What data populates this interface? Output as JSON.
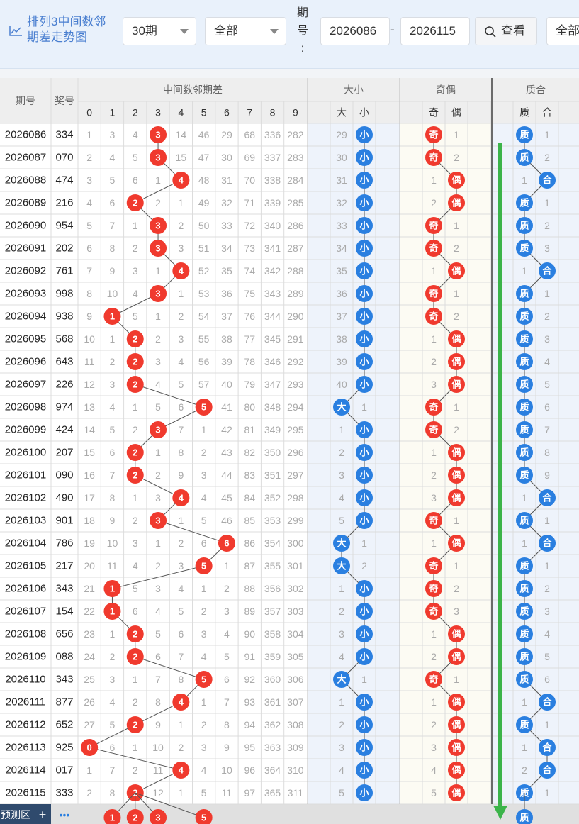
{
  "toolbar": {
    "title": "排列3中间数邻\n期差走势图",
    "period_select": "30期",
    "filter_select": "全部",
    "qihao_label": "期\n号\n:",
    "range_start": "2026086",
    "range_dash": "-",
    "range_end": "2026115",
    "view_button": "查看",
    "filter2_select": "全部"
  },
  "table": {
    "headers": {
      "qihao": "期号",
      "jianghao": "奖号",
      "group_diff": "中间数邻期差",
      "group_size": "大小",
      "group_parity": "奇偶",
      "group_prime": "质合",
      "digits": [
        "0",
        "1",
        "2",
        "3",
        "4",
        "5",
        "6",
        "7",
        "8",
        "9"
      ],
      "size_cols": [
        "大",
        "小"
      ],
      "parity_cols": [
        "奇",
        "偶"
      ],
      "prime_cols": [
        "质",
        "合"
      ]
    },
    "rows": [
      {
        "qihao": "2026086",
        "jianghao": "334",
        "diff": [
          "1",
          "3",
          "4",
          "3",
          "14",
          "46",
          "29",
          "68",
          "336",
          "282"
        ],
        "size": [
          "29",
          "小"
        ],
        "parity": [
          "奇",
          "1"
        ],
        "prime": [
          "质",
          "1"
        ]
      },
      {
        "qihao": "2026087",
        "jianghao": "070",
        "diff": [
          "2",
          "4",
          "5",
          "3",
          "15",
          "47",
          "30",
          "69",
          "337",
          "283"
        ],
        "size": [
          "30",
          "小"
        ],
        "parity": [
          "奇",
          "2"
        ],
        "prime": [
          "质",
          "2"
        ]
      },
      {
        "qihao": "2026088",
        "jianghao": "474",
        "diff": [
          "3",
          "5",
          "6",
          "1",
          "4",
          "48",
          "31",
          "70",
          "338",
          "284"
        ],
        "size": [
          "31",
          "小"
        ],
        "parity": [
          "1",
          "偶"
        ],
        "prime": [
          "1",
          "合"
        ]
      },
      {
        "qihao": "2026089",
        "jianghao": "216",
        "diff": [
          "4",
          "6",
          "2",
          "2",
          "1",
          "49",
          "32",
          "71",
          "339",
          "285"
        ],
        "size": [
          "32",
          "小"
        ],
        "parity": [
          "2",
          "偶"
        ],
        "prime": [
          "质",
          "1"
        ]
      },
      {
        "qihao": "2026090",
        "jianghao": "954",
        "diff": [
          "5",
          "7",
          "1",
          "3",
          "2",
          "50",
          "33",
          "72",
          "340",
          "286"
        ],
        "size": [
          "33",
          "小"
        ],
        "parity": [
          "奇",
          "1"
        ],
        "prime": [
          "质",
          "2"
        ]
      },
      {
        "qihao": "2026091",
        "jianghao": "202",
        "diff": [
          "6",
          "8",
          "2",
          "3",
          "3",
          "51",
          "34",
          "73",
          "341",
          "287"
        ],
        "size": [
          "34",
          "小"
        ],
        "parity": [
          "奇",
          "2"
        ],
        "prime": [
          "质",
          "3"
        ]
      },
      {
        "qihao": "2026092",
        "jianghao": "761",
        "diff": [
          "7",
          "9",
          "3",
          "1",
          "4",
          "52",
          "35",
          "74",
          "342",
          "288"
        ],
        "size": [
          "35",
          "小"
        ],
        "parity": [
          "1",
          "偶"
        ],
        "prime": [
          "1",
          "合"
        ]
      },
      {
        "qihao": "2026093",
        "jianghao": "998",
        "diff": [
          "8",
          "10",
          "4",
          "3",
          "1",
          "53",
          "36",
          "75",
          "343",
          "289"
        ],
        "size": [
          "36",
          "小"
        ],
        "parity": [
          "奇",
          "1"
        ],
        "prime": [
          "质",
          "1"
        ]
      },
      {
        "qihao": "2026094",
        "jianghao": "938",
        "diff": [
          "9",
          "1",
          "5",
          "1",
          "2",
          "54",
          "37",
          "76",
          "344",
          "290"
        ],
        "size": [
          "37",
          "小"
        ],
        "parity": [
          "奇",
          "2"
        ],
        "prime": [
          "质",
          "2"
        ]
      },
      {
        "qihao": "2026095",
        "jianghao": "568",
        "diff": [
          "10",
          "1",
          "2",
          "2",
          "3",
          "55",
          "38",
          "77",
          "345",
          "291"
        ],
        "size": [
          "38",
          "小"
        ],
        "parity": [
          "1",
          "偶"
        ],
        "prime": [
          "质",
          "3"
        ]
      },
      {
        "qihao": "2026096",
        "jianghao": "643",
        "diff": [
          "11",
          "2",
          "2",
          "3",
          "4",
          "56",
          "39",
          "78",
          "346",
          "292"
        ],
        "size": [
          "39",
          "小"
        ],
        "parity": [
          "2",
          "偶"
        ],
        "prime": [
          "质",
          "4"
        ]
      },
      {
        "qihao": "2026097",
        "jianghao": "226",
        "diff": [
          "12",
          "3",
          "2",
          "4",
          "5",
          "57",
          "40",
          "79",
          "347",
          "293"
        ],
        "size": [
          "40",
          "小"
        ],
        "parity": [
          "3",
          "偶"
        ],
        "prime": [
          "质",
          "5"
        ]
      },
      {
        "qihao": "2026098",
        "jianghao": "974",
        "diff": [
          "13",
          "4",
          "1",
          "5",
          "6",
          "5",
          "41",
          "80",
          "348",
          "294"
        ],
        "size": [
          "大",
          "1"
        ],
        "parity": [
          "奇",
          "1"
        ],
        "prime": [
          "质",
          "6"
        ]
      },
      {
        "qihao": "2026099",
        "jianghao": "424",
        "diff": [
          "14",
          "5",
          "2",
          "3",
          "7",
          "1",
          "42",
          "81",
          "349",
          "295"
        ],
        "size": [
          "1",
          "小"
        ],
        "parity": [
          "奇",
          "2"
        ],
        "prime": [
          "质",
          "7"
        ]
      },
      {
        "qihao": "2026100",
        "jianghao": "207",
        "diff": [
          "15",
          "6",
          "2",
          "1",
          "8",
          "2",
          "43",
          "82",
          "350",
          "296"
        ],
        "size": [
          "2",
          "小"
        ],
        "parity": [
          "1",
          "偶"
        ],
        "prime": [
          "质",
          "8"
        ]
      },
      {
        "qihao": "2026101",
        "jianghao": "090",
        "diff": [
          "16",
          "7",
          "2",
          "2",
          "9",
          "3",
          "44",
          "83",
          "351",
          "297"
        ],
        "size": [
          "3",
          "小"
        ],
        "parity": [
          "2",
          "偶"
        ],
        "prime": [
          "质",
          "9"
        ]
      },
      {
        "qihao": "2026102",
        "jianghao": "490",
        "diff": [
          "17",
          "8",
          "1",
          "3",
          "4",
          "4",
          "45",
          "84",
          "352",
          "298"
        ],
        "size": [
          "4",
          "小"
        ],
        "parity": [
          "3",
          "偶"
        ],
        "prime": [
          "1",
          "合"
        ]
      },
      {
        "qihao": "2026103",
        "jianghao": "901",
        "diff": [
          "18",
          "9",
          "2",
          "3",
          "1",
          "5",
          "46",
          "85",
          "353",
          "299"
        ],
        "size": [
          "5",
          "小"
        ],
        "parity": [
          "奇",
          "1"
        ],
        "prime": [
          "质",
          "1"
        ]
      },
      {
        "qihao": "2026104",
        "jianghao": "786",
        "diff": [
          "19",
          "10",
          "3",
          "1",
          "2",
          "6",
          "6",
          "86",
          "354",
          "300"
        ],
        "size": [
          "大",
          "1"
        ],
        "parity": [
          "1",
          "偶"
        ],
        "prime": [
          "1",
          "合"
        ]
      },
      {
        "qihao": "2026105",
        "jianghao": "217",
        "diff": [
          "20",
          "11",
          "4",
          "2",
          "3",
          "5",
          "1",
          "87",
          "355",
          "301"
        ],
        "size": [
          "大",
          "2"
        ],
        "parity": [
          "奇",
          "1"
        ],
        "prime": [
          "质",
          "1"
        ]
      },
      {
        "qihao": "2026106",
        "jianghao": "343",
        "diff": [
          "21",
          "1",
          "5",
          "3",
          "4",
          "1",
          "2",
          "88",
          "356",
          "302"
        ],
        "size": [
          "1",
          "小"
        ],
        "parity": [
          "奇",
          "2"
        ],
        "prime": [
          "质",
          "2"
        ]
      },
      {
        "qihao": "2026107",
        "jianghao": "154",
        "diff": [
          "22",
          "1",
          "6",
          "4",
          "5",
          "2",
          "3",
          "89",
          "357",
          "303"
        ],
        "size": [
          "2",
          "小"
        ],
        "parity": [
          "奇",
          "3"
        ],
        "prime": [
          "质",
          "3"
        ]
      },
      {
        "qihao": "2026108",
        "jianghao": "656",
        "diff": [
          "23",
          "1",
          "2",
          "5",
          "6",
          "3",
          "4",
          "90",
          "358",
          "304"
        ],
        "size": [
          "3",
          "小"
        ],
        "parity": [
          "1",
          "偶"
        ],
        "prime": [
          "质",
          "4"
        ]
      },
      {
        "qihao": "2026109",
        "jianghao": "088",
        "diff": [
          "24",
          "2",
          "2",
          "6",
          "7",
          "4",
          "5",
          "91",
          "359",
          "305"
        ],
        "size": [
          "4",
          "小"
        ],
        "parity": [
          "2",
          "偶"
        ],
        "prime": [
          "质",
          "5"
        ]
      },
      {
        "qihao": "2026110",
        "jianghao": "343",
        "diff": [
          "25",
          "3",
          "1",
          "7",
          "8",
          "5",
          "6",
          "92",
          "360",
          "306"
        ],
        "size": [
          "大",
          "1"
        ],
        "parity": [
          "奇",
          "1"
        ],
        "prime": [
          "质",
          "6"
        ]
      },
      {
        "qihao": "2026111",
        "jianghao": "877",
        "diff": [
          "26",
          "4",
          "2",
          "8",
          "4",
          "1",
          "7",
          "93",
          "361",
          "307"
        ],
        "size": [
          "1",
          "小"
        ],
        "parity": [
          "1",
          "偶"
        ],
        "prime": [
          "1",
          "合"
        ]
      },
      {
        "qihao": "2026112",
        "jianghao": "652",
        "diff": [
          "27",
          "5",
          "2",
          "9",
          "1",
          "2",
          "8",
          "94",
          "362",
          "308"
        ],
        "size": [
          "2",
          "小"
        ],
        "parity": [
          "2",
          "偶"
        ],
        "prime": [
          "质",
          "1"
        ]
      },
      {
        "qihao": "2026113",
        "jianghao": "925",
        "diff": [
          "0",
          "6",
          "1",
          "10",
          "2",
          "3",
          "9",
          "95",
          "363",
          "309"
        ],
        "size": [
          "3",
          "小"
        ],
        "parity": [
          "3",
          "偶"
        ],
        "prime": [
          "1",
          "合"
        ]
      },
      {
        "qihao": "2026114",
        "jianghao": "017",
        "diff": [
          "1",
          "7",
          "2",
          "11",
          "4",
          "4",
          "10",
          "96",
          "364",
          "310"
        ],
        "size": [
          "4",
          "小"
        ],
        "parity": [
          "4",
          "偶"
        ],
        "prime": [
          "2",
          "合"
        ]
      },
      {
        "qihao": "2026115",
        "jianghao": "333",
        "diff": [
          "2",
          "8",
          "2",
          "12",
          "1",
          "5",
          "11",
          "97",
          "365",
          "311"
        ],
        "size": [
          "5",
          "小"
        ],
        "parity": [
          "5",
          "偶"
        ],
        "prime": [
          "质",
          "1"
        ]
      }
    ],
    "hits": [
      3,
      3,
      4,
      2,
      3,
      3,
      4,
      3,
      1,
      2,
      2,
      2,
      5,
      3,
      2,
      2,
      4,
      3,
      6,
      5,
      1,
      1,
      2,
      2,
      5,
      4,
      2,
      0,
      4,
      2
    ],
    "prediction": {
      "label": "预测区",
      "plus": "+",
      "more": "•••",
      "digits": [
        "1",
        "2",
        "3",
        "5"
      ],
      "prime": "质"
    }
  },
  "colors": {
    "red_ball": "#f03a2e",
    "blue_ball": "#2a7fe0",
    "arrow_green": "#3cb44a",
    "header_bg": "#eeeeee",
    "pred_label_bg": "#2f4a6d"
  }
}
